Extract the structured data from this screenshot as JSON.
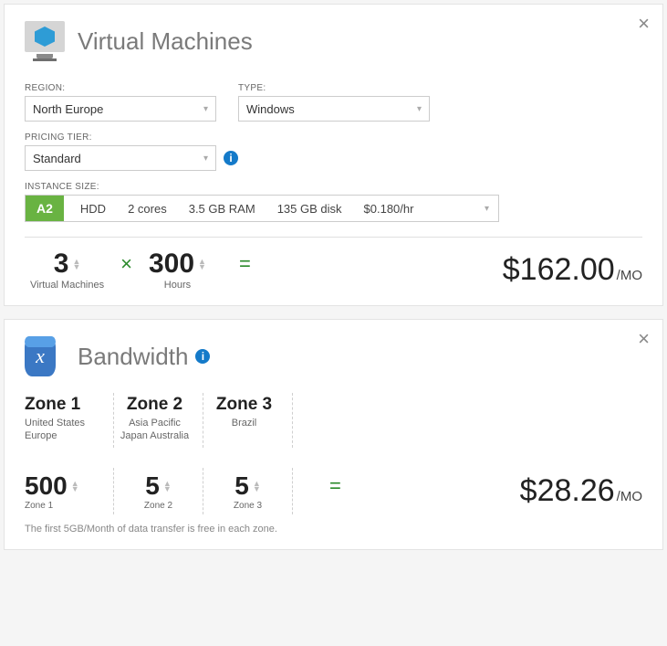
{
  "vm": {
    "title": "Virtual Machines",
    "labels": {
      "region": "REGION:",
      "type": "TYPE:",
      "tier": "PRICING TIER:",
      "instance": "INSTANCE SIZE:"
    },
    "region": "North Europe",
    "type": "Windows",
    "tier": "Standard",
    "instance": {
      "code": "A2",
      "storage": "HDD",
      "cores": "2 cores",
      "ram": "3.5 GB RAM",
      "disk": "135 GB disk",
      "rate": "$0.180/hr"
    },
    "qty": {
      "value": "3",
      "label": "Virtual Machines"
    },
    "hours": {
      "value": "300",
      "label": "Hours"
    },
    "price": {
      "amount": "$162.00",
      "unit": "/MO"
    }
  },
  "bw": {
    "title": "Bandwidth",
    "zones": [
      {
        "name": "Zone 1",
        "sub": "United States Europe"
      },
      {
        "name": "Zone 2",
        "sub": "Asia Pacific Japan Australia"
      },
      {
        "name": "Zone 3",
        "sub": "Brazil"
      }
    ],
    "values": [
      {
        "v": "500",
        "label": "Zone 1"
      },
      {
        "v": "5",
        "label": "Zone 2"
      },
      {
        "v": "5",
        "label": "Zone 3"
      }
    ],
    "price": {
      "amount": "$28.26",
      "unit": "/MO"
    },
    "footnote": "The first 5GB/Month of data transfer is free in each zone."
  }
}
